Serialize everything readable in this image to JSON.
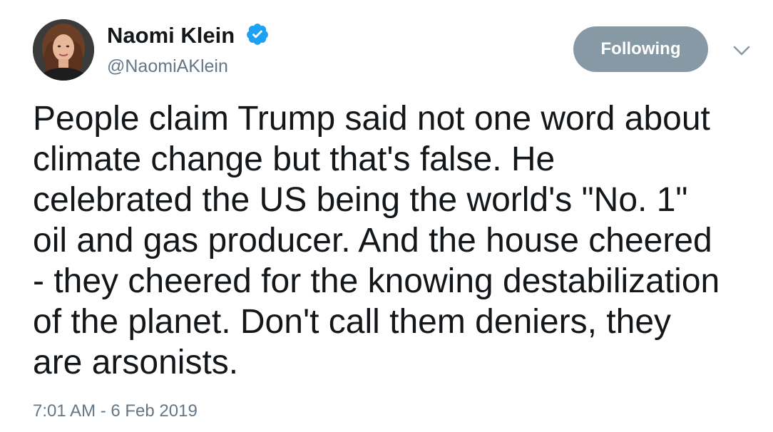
{
  "author": {
    "display_name": "Naomi Klein",
    "handle": "@NaomiAKlein",
    "verified": true,
    "avatar_icon": "profile-photo"
  },
  "actions": {
    "follow_label": "Following",
    "follow_color": "#8899a6",
    "menu_icon": "chevron-down-icon"
  },
  "tweet": {
    "text": "People claim Trump said not one word about\nclimate change but that's false. He\ncelebrated the US being the world's \"No. 1\"\noil and gas producer. And the house cheered\n- they cheered for the knowing destabilization\nof the planet. Don't call them deniers, they\nare arsonists.",
    "timestamp": "7:01 AM - 6 Feb 2019"
  },
  "colors": {
    "verified_blue": "#1da1f2",
    "secondary_text": "#657786",
    "primary_text": "#14171a"
  }
}
